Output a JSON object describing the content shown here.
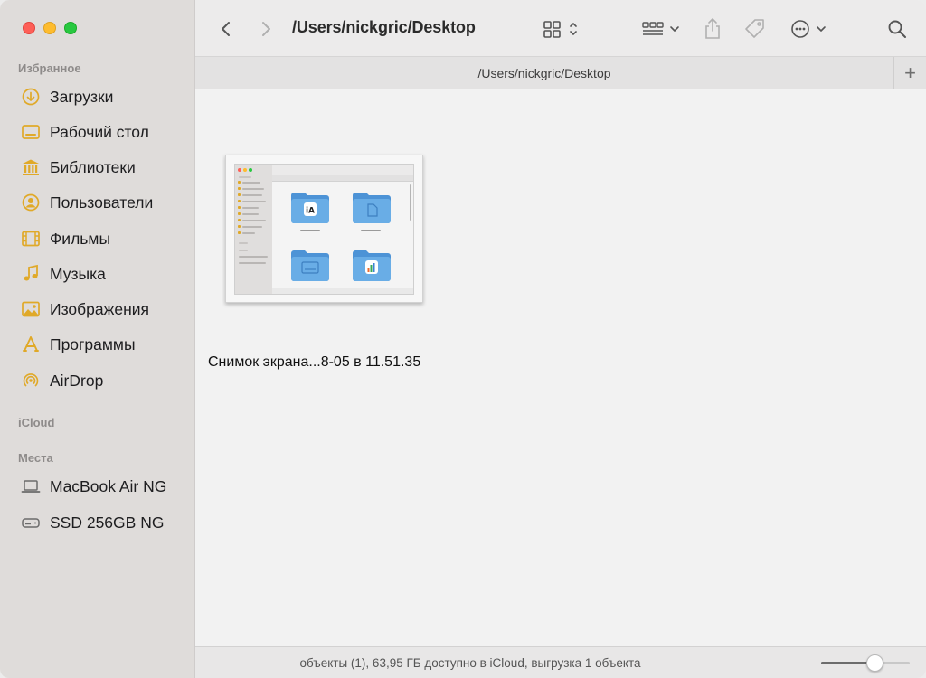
{
  "window": {
    "title": "/Users/nickgric/Desktop",
    "tab_title": "/Users/nickgric/Desktop",
    "tab_add_label": "+"
  },
  "sidebar": {
    "favorites_header": "Избранное",
    "favorites": [
      {
        "label": "Загрузки",
        "icon": "downloads-icon"
      },
      {
        "label": "Рабочий стол",
        "icon": "desktop-icon"
      },
      {
        "label": "Библиотеки",
        "icon": "library-icon"
      },
      {
        "label": "Пользователи",
        "icon": "users-icon"
      },
      {
        "label": "Фильмы",
        "icon": "movies-icon"
      },
      {
        "label": "Музыка",
        "icon": "music-icon"
      },
      {
        "label": "Изображения",
        "icon": "pictures-icon"
      },
      {
        "label": "Программы",
        "icon": "applications-icon"
      },
      {
        "label": "AirDrop",
        "icon": "airdrop-icon"
      }
    ],
    "icloud_header": "iCloud",
    "locations_header": "Места",
    "locations": [
      {
        "label": "MacBook Air NG",
        "icon": "laptop-icon"
      },
      {
        "label": "SSD 256GB NG",
        "icon": "disk-icon"
      }
    ]
  },
  "content": {
    "files": [
      {
        "name": "Снимок экрана...8-05 в 11.51.35",
        "kind": "screenshot-thumbnail"
      }
    ]
  },
  "statusbar": {
    "text": "объекты (1), 63,95 ГБ доступно в iCloud, выгрузка 1 объекта",
    "icon_size_fraction": 0.6
  },
  "colors": {
    "accent_icon": "#e0a928",
    "sidebar_bg": "#dfdcda",
    "folder_blue": "#64a8e4"
  }
}
